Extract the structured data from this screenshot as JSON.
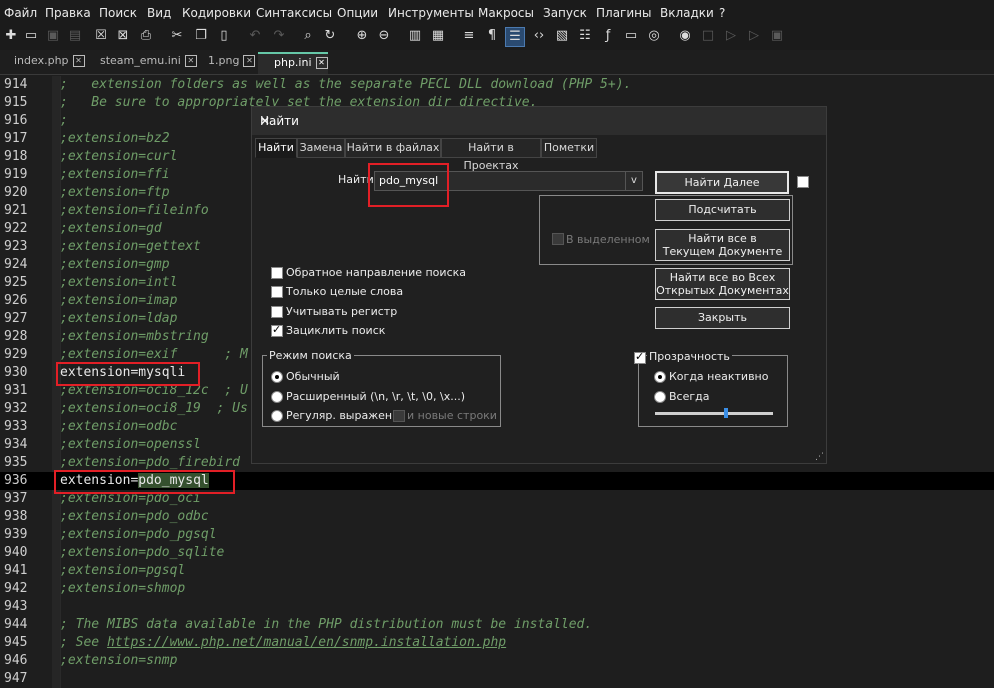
{
  "menu": [
    "Файл",
    "Правка",
    "Поиск",
    "Вид",
    "Кодировки",
    "Синтаксисы",
    "Опции",
    "Инструменты",
    "Макросы",
    "Запуск",
    "Плагины",
    "Вкладки",
    "?"
  ],
  "toolbar_icons": [
    "new-file-icon",
    "open-file-icon",
    "save-icon",
    "save-all-icon",
    "close-icon",
    "close-all-icon",
    "print-icon",
    "cut-icon",
    "copy-icon",
    "paste-icon",
    "undo-icon",
    "redo-icon",
    "find-icon",
    "replace-icon",
    "zoom-in-icon",
    "zoom-out-icon",
    "sync-vertical-icon",
    "sync-horizontal-icon",
    "word-wrap-icon",
    "show-all-chars-icon",
    "indent-guide-icon",
    "xml-tag-icon",
    "doc-map-icon",
    "function-list-icon",
    "fx-icon",
    "monitor-icon",
    "folder-workspace-icon",
    "record-icon",
    "stop-icon",
    "play-icon",
    "play-multiple-icon",
    "save-macro-icon"
  ],
  "tabs": [
    {
      "label": "index.php"
    },
    {
      "label": "steam_emu.ini"
    },
    {
      "label": "1.png"
    },
    {
      "label": "php.ini"
    }
  ],
  "editor": {
    "lines": [
      {
        "num": "914",
        "text": ";   extension folders as well as the separate PECL DLL download (PHP 5+)."
      },
      {
        "num": "915",
        "text": ";   Be sure to appropriately set the extension_dir directive."
      },
      {
        "num": "916",
        "text": ";"
      },
      {
        "num": "917",
        "text": ";extension=bz2"
      },
      {
        "num": "918",
        "text": ";extension=curl"
      },
      {
        "num": "919",
        "text": ";extension=ffi"
      },
      {
        "num": "920",
        "text": ";extension=ftp"
      },
      {
        "num": "921",
        "text": ";extension=fileinfo"
      },
      {
        "num": "922",
        "text": ";extension=gd"
      },
      {
        "num": "923",
        "text": ";extension=gettext"
      },
      {
        "num": "924",
        "text": ";extension=gmp"
      },
      {
        "num": "925",
        "text": ";extension=intl"
      },
      {
        "num": "926",
        "text": ";extension=imap"
      },
      {
        "num": "927",
        "text": ";extension=ldap"
      },
      {
        "num": "928",
        "text": ";extension=mbstring"
      },
      {
        "num": "929",
        "text": ";extension=exif      ; M"
      },
      {
        "num": "930",
        "text": "extension=mysqli"
      },
      {
        "num": "931",
        "text": ";extension=oci8_12c  ; U"
      },
      {
        "num": "932",
        "text": ";extension=oci8_19  ; Us"
      },
      {
        "num": "933",
        "text": ";extension=odbc"
      },
      {
        "num": "934",
        "text": ";extension=openssl"
      },
      {
        "num": "935",
        "text": ";extension=pdo_firebird"
      },
      {
        "num": "936",
        "text_prefix": "extension=",
        "text_match": "pdo_mysql"
      },
      {
        "num": "937",
        "text": ";extension=pdo_oci"
      },
      {
        "num": "938",
        "text": ";extension=pdo_odbc"
      },
      {
        "num": "939",
        "text": ";extension=pdo_pgsql"
      },
      {
        "num": "940",
        "text": ";extension=pdo_sqlite"
      },
      {
        "num": "941",
        "text": ";extension=pgsql"
      },
      {
        "num": "942",
        "text": ";extension=shmop"
      },
      {
        "num": "943",
        "text": ""
      },
      {
        "num": "944",
        "text": "; The MIBS data available in the PHP distribution must be installed."
      },
      {
        "num": "945",
        "text_prefix": "; See ",
        "text_link": "https://www.php.net/manual/en/snmp.installation.php"
      },
      {
        "num": "946",
        "text": ";extension=snmp"
      },
      {
        "num": "947",
        "text": ""
      }
    ]
  },
  "dialog": {
    "title": "Найти",
    "tabs": [
      "Найти",
      "Замена",
      "Найти в файлах",
      "Найти в Проектах",
      "Пометки"
    ],
    "find_label": "Найти:",
    "find_value": "pdo_mysql",
    "find_dropdown": "v",
    "buttons": {
      "find_next": "Найти Далее",
      "count": "Подсчитать",
      "find_all_current_1": "Найти все в",
      "find_all_current_2": "Текущем Документе",
      "find_all_open_1": "Найти все во Всех",
      "find_all_open_2": "Открытых Документах",
      "close": "Закрыть"
    },
    "in_selection": "В выделенном",
    "options": {
      "backward": "Обратное направление поиска",
      "whole_word": "Только целые слова",
      "match_case": "Учитывать регистр",
      "wrap": "Зациклить поиск"
    },
    "search_mode": {
      "title": "Режим поиска",
      "normal": "Обычный",
      "extended": "Расширенный (\\n, \\r, \\t, \\0, \\x...)",
      "regex": "Регуляр. выражен.",
      "newline": "и новые строки"
    },
    "transparency": {
      "title": "Прозрачность",
      "on_lose_focus": "Когда неактивно",
      "always": "Всегда",
      "level": 0.6
    }
  },
  "colors": {
    "highlight_box": "#e21f26",
    "comment": "#6f9d68",
    "match_bg": "#35502e",
    "tab_accent": "#66c8a8"
  }
}
